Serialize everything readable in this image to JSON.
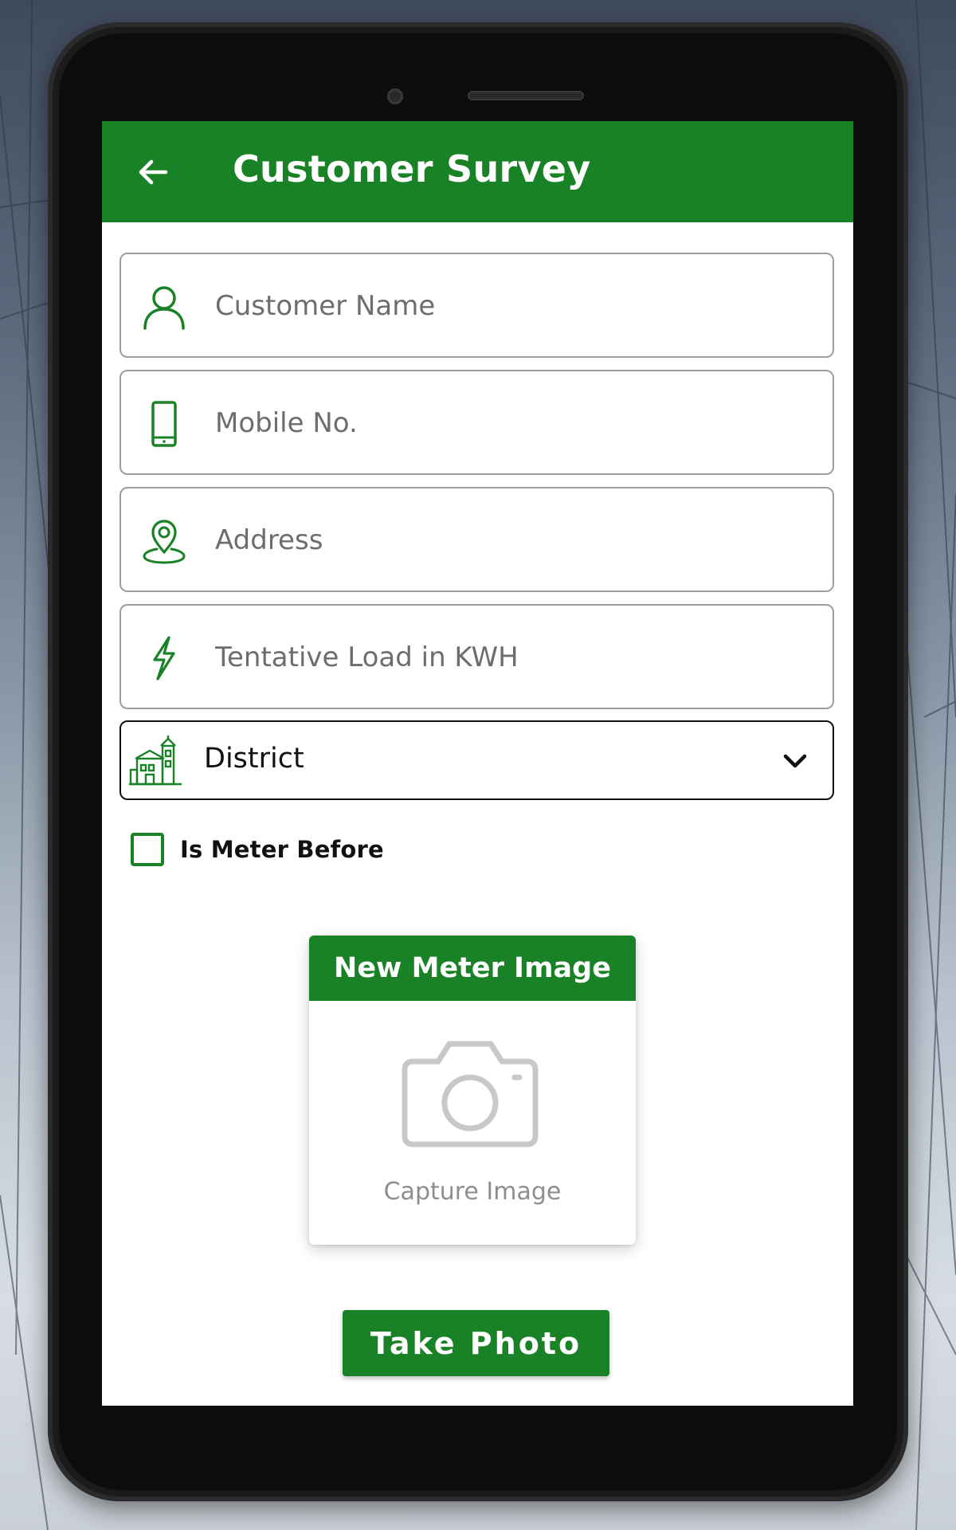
{
  "appbar": {
    "title": "Customer Survey",
    "back_icon": "arrow-left-icon"
  },
  "form": {
    "customer_name": {
      "placeholder": "Customer Name",
      "value": "",
      "icon": "person-icon"
    },
    "mobile_no": {
      "placeholder": "Mobile No.",
      "value": "",
      "icon": "phone-icon"
    },
    "address": {
      "placeholder": "Address",
      "value": "",
      "icon": "location-pin-icon"
    },
    "tentative_load": {
      "placeholder": "Tentative Load in KWH",
      "value": "",
      "icon": "lightning-icon"
    },
    "district": {
      "selected": "District",
      "icon": "building-icon",
      "chevron": "chevron-down-icon"
    },
    "is_meter_before": {
      "label": "Is Meter Before",
      "checked": false
    }
  },
  "image_card": {
    "title": "New Meter Image",
    "caption": "Capture Image",
    "icon": "camera-icon"
  },
  "actions": {
    "take_photo_label": "Take Photo"
  },
  "colors": {
    "primary": "#1a8226",
    "field_border": "#9e9e9e",
    "placeholder": "#6d6d6d",
    "caption": "#8e8e8e"
  }
}
